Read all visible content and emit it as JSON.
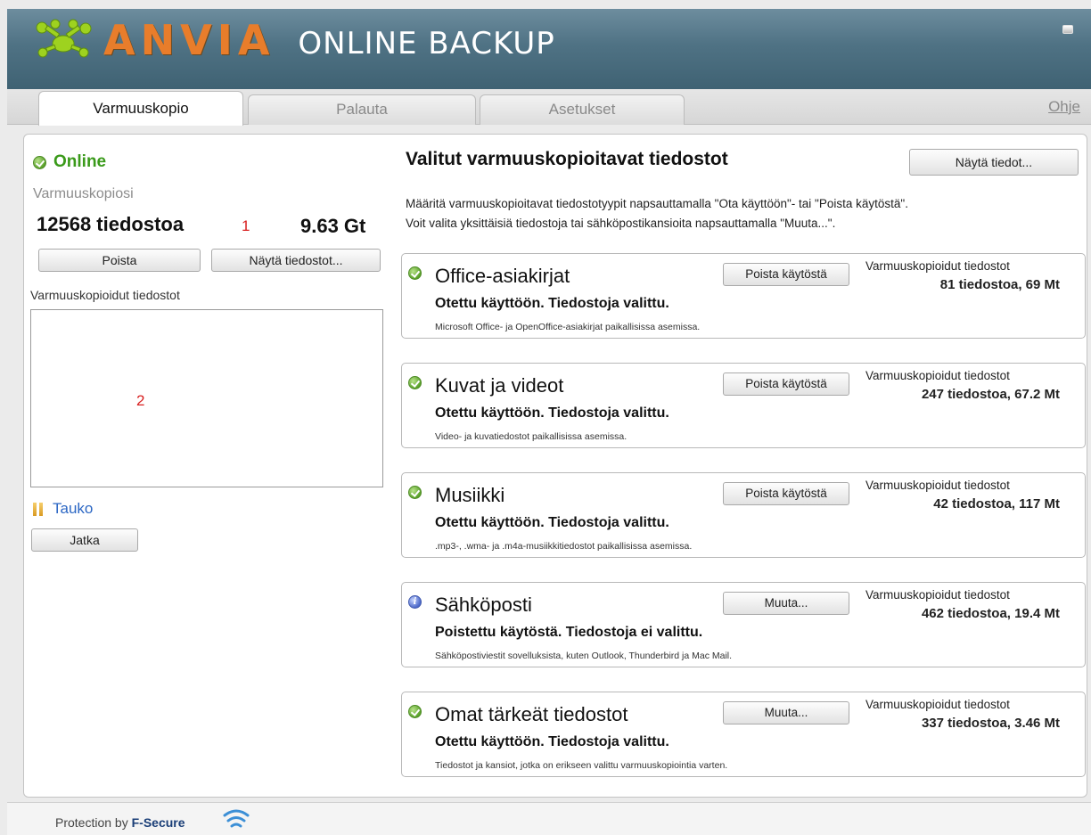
{
  "header": {
    "brand": "ANVIA",
    "product": "ONLINE BACKUP",
    "colors": {
      "brand": "#e87d2b",
      "header_bg": "#4f7284"
    },
    "icons": {
      "logo": "anvia-logo-icon",
      "window_button": "minimize-icon"
    }
  },
  "tabs": [
    {
      "label": "Varmuuskopio",
      "active": true
    },
    {
      "label": "Palauta",
      "active": false
    },
    {
      "label": "Asetukset",
      "active": false
    }
  ],
  "help_link": "Ohje",
  "left": {
    "status": "Online",
    "backups_label": "Varmuuskopiosi",
    "file_count": "12568 tiedostoa",
    "marker_1": "1",
    "total_size": "9.63 Gt",
    "delete_button": "Poista",
    "show_files_button": "Näytä tiedostot...",
    "backed_up_label": "Varmuuskopioidut tiedostot",
    "marker_2": "2",
    "pause_label": "Tauko",
    "continue_button": "Jatka"
  },
  "right": {
    "title": "Valitut varmuuskopioitavat tiedostot",
    "show_details_button": "Näytä tiedot...",
    "description_line_1": "Määritä varmuuskopioitavat tiedostotyypit napsauttamalla \"Ota käyttöön\"- tai \"Poista käytöstä\".",
    "description_line_2": "Voit valita yksittäisiä tiedostoja tai sähköpostikansioita napsauttamalla \"Muuta...\".",
    "cards": [
      {
        "title": "Office-asiakirjat",
        "status": "Otettu käyttöön. Tiedostoja valittu.",
        "description": "Microsoft Office- ja OpenOffice-asiakirjat paikallisissa asemissa.",
        "button": "Poista käytöstä",
        "stats_label": "Varmuuskopioidut tiedostot",
        "stats_value": "81 tiedostoa, 69 Mt",
        "icon": "check-icon"
      },
      {
        "title": "Kuvat ja videot",
        "status": "Otettu käyttöön. Tiedostoja valittu.",
        "description": "Video- ja kuvatiedostot paikallisissa asemissa.",
        "button": "Poista käytöstä",
        "stats_label": "Varmuuskopioidut tiedostot",
        "stats_value": "247 tiedostoa, 67.2 Mt",
        "icon": "check-icon"
      },
      {
        "title": "Musiikki",
        "status": "Otettu käyttöön. Tiedostoja valittu.",
        "description": ".mp3-, .wma- ja .m4a-musiikkitiedostot paikallisissa asemissa.",
        "button": "Poista käytöstä",
        "stats_label": "Varmuuskopioidut tiedostot",
        "stats_value": "42 tiedostoa, 117 Mt",
        "icon": "check-icon"
      },
      {
        "title": "Sähköposti",
        "status": "Poistettu käytöstä. Tiedostoja ei valittu.",
        "description": "Sähköpostiviestit sovelluksista, kuten Outlook, Thunderbird ja Mac Mail.",
        "button": "Muuta...",
        "stats_label": "Varmuuskopioidut tiedostot",
        "stats_value": "462 tiedostoa, 19.4 Mt",
        "icon": "info-icon"
      },
      {
        "title": "Omat tärkeät tiedostot",
        "status": "Otettu käyttöön. Tiedostoja valittu.",
        "description": "Tiedostot ja kansiot, jotka on erikseen valittu varmuuskopiointia varten.",
        "button": "Muuta...",
        "stats_label": "Varmuuskopioidut tiedostot",
        "stats_value": "337 tiedostoa, 3.46 Mt",
        "icon": "check-icon"
      }
    ]
  },
  "footer": {
    "prefix": "Protection by ",
    "brand": "F-Secure",
    "icon": "f-secure-logo-icon"
  }
}
